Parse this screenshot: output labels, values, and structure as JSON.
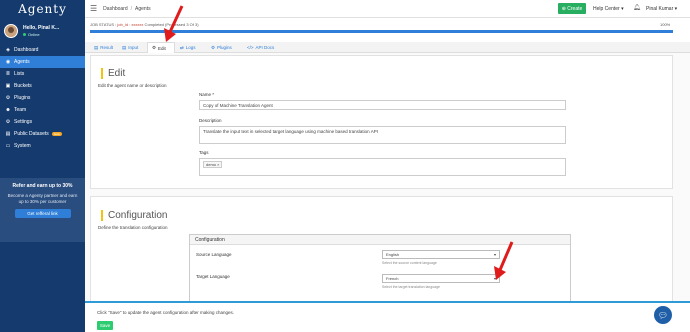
{
  "logo": "Agenty",
  "user": {
    "greeting": "Hello, Pinal K...",
    "status": "Online"
  },
  "sidebar": {
    "items": [
      {
        "label": "Dashboard",
        "icon": "◈"
      },
      {
        "label": "Agents",
        "icon": "◉"
      },
      {
        "label": "Lists",
        "icon": "≣"
      },
      {
        "label": "Buckets",
        "icon": "▣"
      },
      {
        "label": "Plugins",
        "icon": "⚙"
      },
      {
        "label": "Team",
        "icon": "☻"
      },
      {
        "label": "Settings",
        "icon": "⚙"
      },
      {
        "label": "Public Datasets",
        "icon": "▤",
        "badge": "beta"
      },
      {
        "label": "System",
        "icon": "▭"
      }
    ]
  },
  "refer": {
    "title": "Refer and earn up to 30%",
    "text": "Become a Agenty partner and earn up to 30% per customer",
    "button": "Get refferal link"
  },
  "topbar": {
    "breadcrumb": [
      "Dashboard",
      "Agents"
    ],
    "create": "Create",
    "help": "Help Center ▾",
    "username": "Pinal Kumar ▾"
  },
  "job": {
    "prefix": "JOB STATUS : ",
    "id": "job_id : xxxxxx",
    "status": " Completed (Processed 3 Of 3)",
    "percent": "100%",
    "progress": 1.0
  },
  "tabs": [
    {
      "label": "Result",
      "icon": "▤"
    },
    {
      "label": "Input",
      "icon": "▤"
    },
    {
      "label": "Edit",
      "icon": "⚙"
    },
    {
      "label": "Logs",
      "icon": "⇄"
    },
    {
      "label": "Plugins",
      "icon": "⚙"
    },
    {
      "label": "API Docs",
      "icon": "</>"
    }
  ],
  "edit": {
    "title": "Edit",
    "desc": "Edit the agent name or description",
    "name_label": "Name *",
    "name_value": "Copy of Machine Translation Agent",
    "description_label": "Description",
    "description_value": "Translate the input text in selected target language using machine based translation API",
    "tags_label": "Tags",
    "tag": "demo ×"
  },
  "config": {
    "title": "Configuration",
    "desc": "Define the translation configuration",
    "panel_title": "Configuration",
    "source_label": "Source Language",
    "source_value": "English",
    "source_help": "Select the source content language",
    "target_label": "Target Language",
    "target_value": "French",
    "target_help": "Select the target translation language"
  },
  "footer": {
    "text": "Click \"Save\" to update the agent configuration after making changes.",
    "save": "Save"
  },
  "colors": {
    "sidebar": "#143a6e",
    "accent": "#2f7fd8",
    "create": "#27ae60",
    "annotation_arrow": "#e01b1b"
  }
}
